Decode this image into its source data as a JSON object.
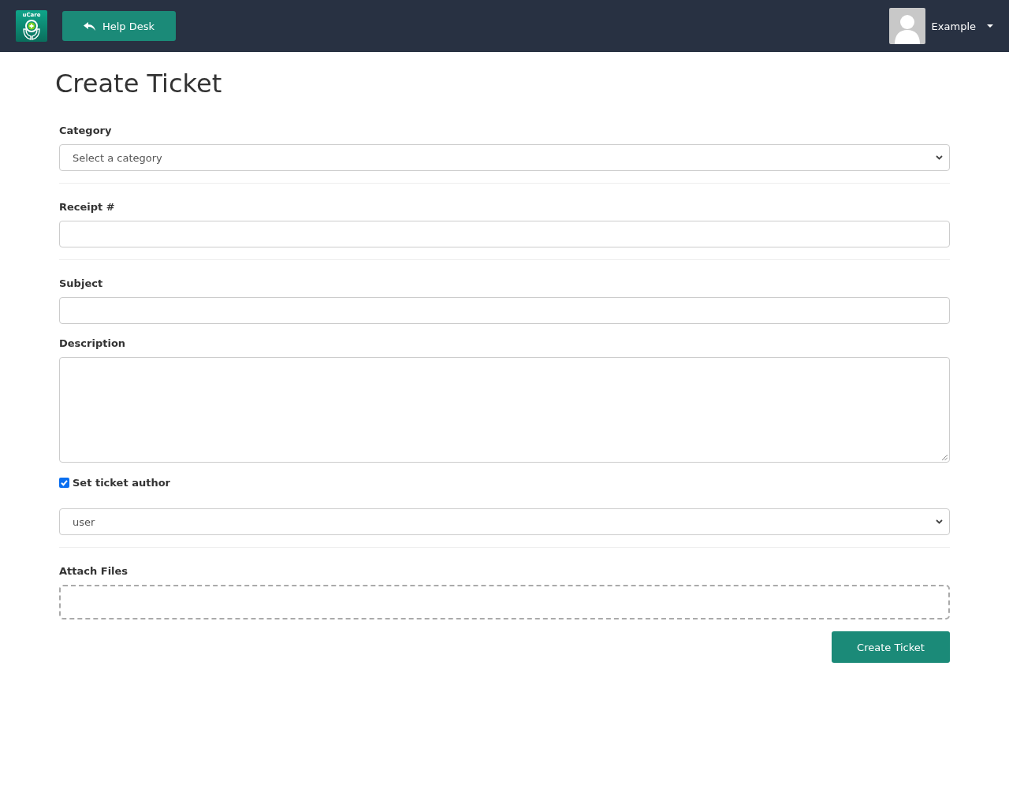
{
  "navbar": {
    "logo": {
      "text": "uCare"
    },
    "back_button": {
      "label": "Help Desk"
    },
    "user_menu": {
      "name": "Example"
    }
  },
  "page_title": "Create Ticket",
  "form": {
    "sections": [
      {
        "fields": [
          {
            "kind": "select",
            "label": "Category",
            "value": "Select a category"
          }
        ]
      },
      {
        "fields": [
          {
            "kind": "text",
            "label": "Receipt #"
          }
        ]
      },
      {
        "fields": [
          {
            "kind": "text",
            "label": "Subject"
          },
          {
            "kind": "textarea",
            "label": "Description"
          },
          {
            "kind": "checkbox",
            "label": "Set ticket author",
            "checked": true
          },
          {
            "kind": "select",
            "value": "user"
          }
        ]
      },
      {
        "fields": [
          {
            "kind": "dropzone",
            "label": "Attach Files"
          }
        ]
      }
    ],
    "submit_button": {
      "label": "Create Ticket"
    }
  }
}
